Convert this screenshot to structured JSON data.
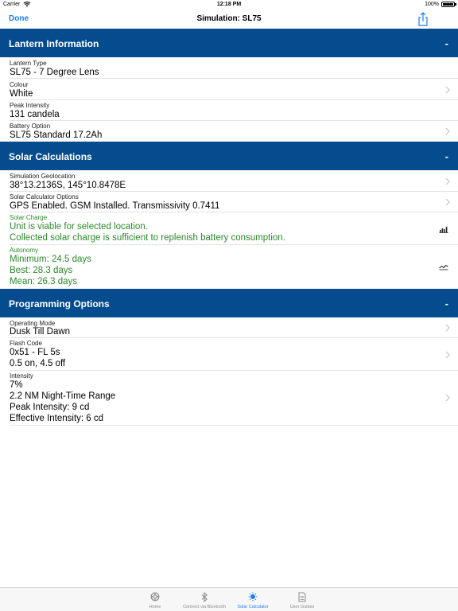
{
  "status_bar": {
    "carrier": "Carrier",
    "time": "12:18 PM",
    "battery": "100%"
  },
  "nav": {
    "done_label": "Done",
    "title": "Simulation: SL75"
  },
  "sections": {
    "lantern": {
      "title": "Lantern Information",
      "collapse": "-"
    },
    "solar": {
      "title": "Solar Calculations",
      "collapse": "-"
    },
    "programming": {
      "title": "Programming Options",
      "collapse": "-"
    }
  },
  "lantern": {
    "type": {
      "label": "Lantern Type",
      "value": "SL75 - 7 Degree Lens"
    },
    "colour": {
      "label": "Colour",
      "value": "White"
    },
    "peak_intensity": {
      "label": "Peak Intensity",
      "value": "131 candela"
    },
    "battery": {
      "label": "Battery Option",
      "value": "SL75 Standard 17.2Ah"
    }
  },
  "solar": {
    "geolocation": {
      "label": "Simulation Geolocation",
      "value": "38°13.2136S, 145°10.8478E"
    },
    "options": {
      "label": "Solar Calculator Options",
      "value": "GPS Enabled. GSM Installed. Transmissivity 0.7411"
    },
    "charge": {
      "label": "Solar Charge",
      "line1": "Unit is viable for selected location.",
      "line2": "Collected solar charge is sufficient to replenish battery consumption."
    },
    "autonomy": {
      "label": "Autonomy",
      "line1": "Minimum: 24.5 days",
      "line2": "Best: 28.3 days",
      "line3": "Mean: 26.3 days"
    }
  },
  "programming": {
    "mode": {
      "label": "Operating Mode",
      "value": "Dusk Till Dawn"
    },
    "flash": {
      "label": "Flash Code",
      "line1": "0x51 - FL 5s",
      "line2": "0.5 on, 4.5 off"
    },
    "intensity": {
      "label": "Intensity",
      "line1": "7%",
      "line2": "2.2 NM Night-Time Range",
      "line3": "Peak Intensity: 9 cd",
      "line4": "Effective Intensity: 6 cd"
    }
  },
  "tabs": [
    {
      "label": "Home",
      "icon": "lifebuoy-icon"
    },
    {
      "label": "Connect via Bluetooth",
      "icon": "bluetooth-icon"
    },
    {
      "label": "Solar Calculator",
      "icon": "sun-icon"
    },
    {
      "label": "User Guides",
      "icon": "document-icon"
    }
  ],
  "colors": {
    "header": "#054c8f",
    "accent": "#1a7ef2",
    "success": "#2a8a2a"
  }
}
